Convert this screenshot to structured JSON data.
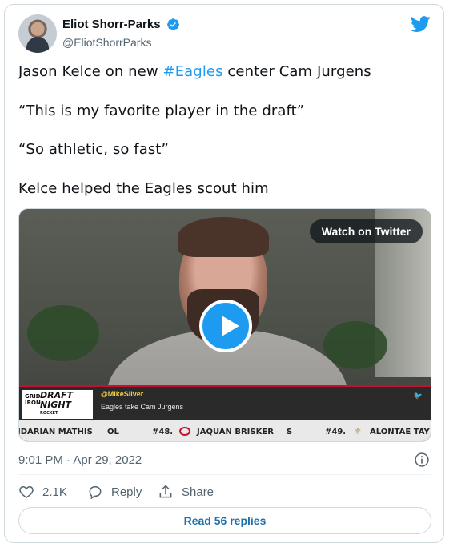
{
  "tweet": {
    "author_name": "Eliot Shorr-Parks",
    "handle": "@EliotShorrParks",
    "lines": [
      {
        "before": "Jason Kelce on new ",
        "hashtag": "#Eagles",
        "after": " center Cam Jurgens"
      },
      {
        "text": "“This is my favorite player in the draft”"
      },
      {
        "text": "“So athletic, so fast”"
      },
      {
        "text": "Kelce helped the Eagles scout him"
      }
    ],
    "timestamp": "9:01 PM · Apr 29, 2022",
    "likes": "2.1K",
    "reply_label": "Reply",
    "share_label": "Share",
    "read_replies_label": "Read 56 replies"
  },
  "media": {
    "watch_label": "Watch on Twitter",
    "logo_small": "GRID IRON",
    "logo_line1": "DRAFT",
    "logo_line2": "NIGHT",
    "logo_sponsor": "ROCKET",
    "lower_third_handle": "@MikeSilver",
    "lower_third_caption": "Eagles take Cam Jurgens",
    "ticker": {
      "item1": "IDARIAN MATHIS",
      "item1_pos": "OL",
      "item2_pick": "#48.",
      "item2_name": "JAQUAN BRISKER",
      "item2_pos": "S",
      "item3_pick": "#49.",
      "item3_name": "ALONTAE TAY"
    }
  },
  "colors": {
    "accent": "#1d9bf0",
    "link": "#1d70a9",
    "muted": "#536471"
  }
}
